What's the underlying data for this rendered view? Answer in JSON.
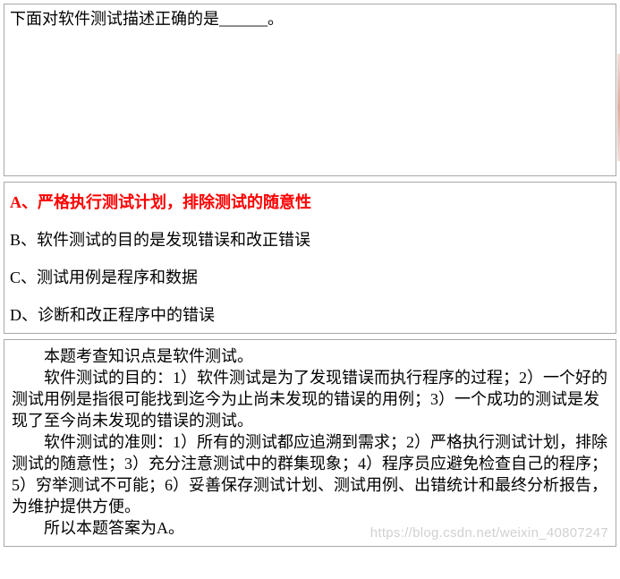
{
  "question": {
    "text": "下面对软件测试描述正确的是______。"
  },
  "options": [
    {
      "label": "A、严格执行测试计划，排除测试的随意性",
      "selected": true
    },
    {
      "label": "B、软件测试的目的是发现错误和改正错误",
      "selected": false
    },
    {
      "label": "C、测试用例是程序和数据",
      "selected": false
    },
    {
      "label": "D、诊断和改正程序中的错误",
      "selected": false
    }
  ],
  "explanation": {
    "p1": "本题考查知识点是软件测试。",
    "p2": "软件测试的目的：1）软件测试是为了发现错误而执行程序的过程；2）一个好的测试用例是指很可能找到迄今为止尚未发现的错误的用例；3）一个成功的测试是发现了至今尚未发现的错误的测试。",
    "p3": "软件测试的准则：1）所有的测试都应追溯到需求；2）严格执行测试计划，排除测试的随意性；3）充分注意测试中的群集现象；4）程序员应避免检查自己的程序；5）穷举测试不可能；6）妥善保存测试计划、测试用例、出错统计和最终分析报告，为维护提供方便。",
    "p4": "所以本题答案为A。"
  },
  "watermark": "https://blog.csdn.net/weixin_40807247"
}
